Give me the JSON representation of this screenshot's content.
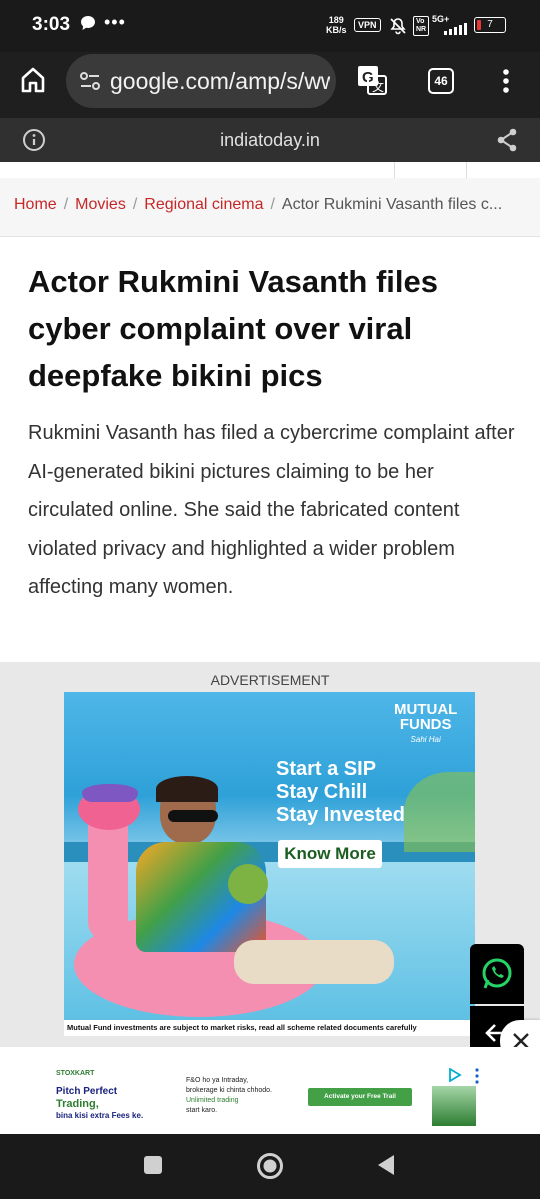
{
  "status_bar": {
    "time": "3:03",
    "dots": "•••",
    "speed_value": "189",
    "speed_unit": "KB/s",
    "vpn": "VPN",
    "volte": "Vo\nNR",
    "network": "5G+",
    "battery": "7"
  },
  "browser": {
    "url": "google.com/amp/s/ww",
    "tab_count": "46",
    "site_domain": "indiatoday.in"
  },
  "breadcrumb": {
    "items": [
      "Home",
      "Movies",
      "Regional cinema"
    ],
    "separator": "/",
    "current": "Actor Rukmini Vasanth files c..."
  },
  "article": {
    "headline": "Actor Rukmini Vasanth files cyber complaint over viral deepfake bikini pics",
    "summary": "Rukmini Vasanth has filed a cybercrime complaint after AI-generated bikini pictures claiming to be her circulated online. She said the fabricated content violated privacy and highlighted a wider problem affecting many women."
  },
  "ad": {
    "label": "ADVERTISEMENT",
    "brand_line1": "MUTUAL",
    "brand_line2": "FUNDS",
    "brand_tag": "Sahi Hai",
    "headline_1": "Start a SIP",
    "headline_2": "Stay Chill",
    "headline_3": "Stay Invested",
    "cta": "Know More",
    "disclaimer": "Mutual Fund investments are subject to market risks, read all scheme related documents carefully"
  },
  "banner_ad": {
    "brand": "STOXKART",
    "line1": "Pitch Perfect",
    "line2": "Trading,",
    "line3": "bina kisi extra Fees ke.",
    "mid1": "F&O ho ya Intraday,",
    "mid2": "brokerage ki chinta chhodo.",
    "mid3": "Unlimited trading",
    "mid4": "start karo.",
    "cta": "Activate your Free Trail"
  },
  "colors": {
    "accent_red": "#c62828",
    "whatsapp_green": "#25d366",
    "cta_green": "#2e7d32"
  }
}
